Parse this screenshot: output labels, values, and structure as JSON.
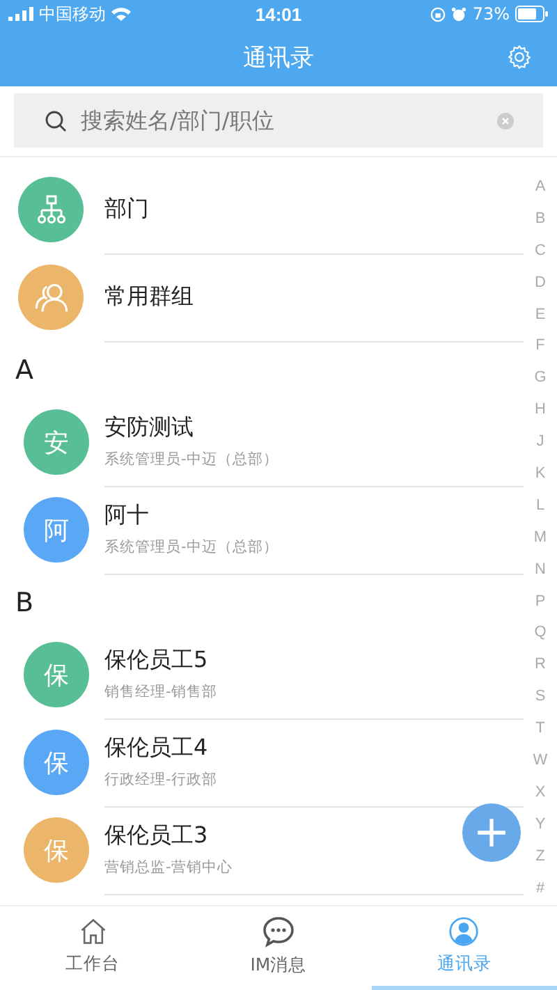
{
  "status_bar": {
    "carrier": "中国移动",
    "time": "14:01",
    "battery": "73%"
  },
  "header": {
    "title": "通讯录"
  },
  "search": {
    "placeholder": "搜索姓名/部门/职位"
  },
  "shortcuts": [
    {
      "kind": "department",
      "label": "部门",
      "color": "#58be95"
    },
    {
      "kind": "groups",
      "label": "常用群组",
      "color": "#ecb66a"
    }
  ],
  "sections": [
    {
      "letter": "A",
      "contacts": [
        {
          "avatar": "安",
          "name": "安防测试",
          "role": "系统管理员-中迈（总部）",
          "color": "#58be95"
        },
        {
          "avatar": "阿",
          "name": "阿十",
          "role": "系统管理员-中迈（总部）",
          "color": "#5aa8f5"
        }
      ]
    },
    {
      "letter": "B",
      "contacts": [
        {
          "avatar": "保",
          "name": "保伦员工5",
          "role": "销售经理-销售部",
          "color": "#58be95"
        },
        {
          "avatar": "保",
          "name": "保伦员工4",
          "role": "行政经理-行政部",
          "color": "#5aa8f5"
        },
        {
          "avatar": "保",
          "name": "保伦员工3",
          "role": "营销总监-营销中心",
          "color": "#ecb66a"
        }
      ]
    }
  ],
  "index": [
    "A",
    "B",
    "C",
    "D",
    "E",
    "F",
    "G",
    "H",
    "J",
    "K",
    "L",
    "M",
    "N",
    "P",
    "Q",
    "R",
    "S",
    "T",
    "W",
    "X",
    "Y",
    "Z",
    "#"
  ],
  "tabs": [
    {
      "kind": "home",
      "label": "工作台",
      "selected": false
    },
    {
      "kind": "chat",
      "label": "IM消息",
      "selected": false
    },
    {
      "kind": "contacts",
      "label": "通讯录",
      "selected": true
    }
  ]
}
